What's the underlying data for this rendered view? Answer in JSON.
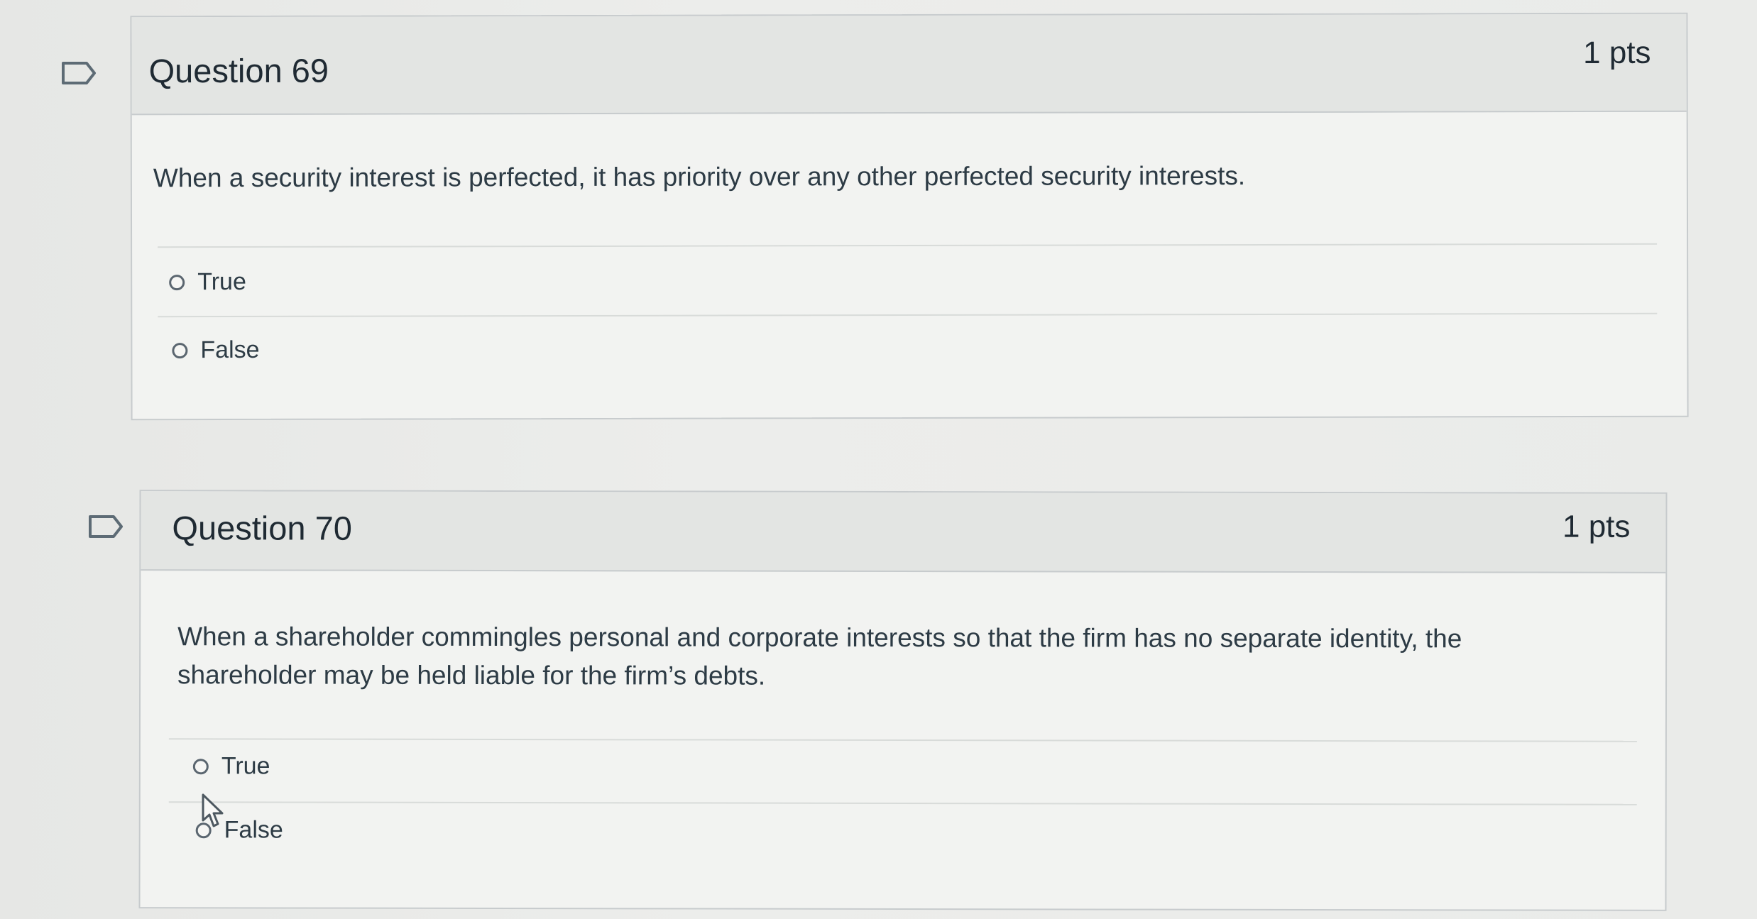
{
  "questions": [
    {
      "title": "Question 69",
      "points": "1 pts",
      "text": "When a security interest is perfected, it has priority over any other perfected security interests.",
      "answers": [
        "True",
        "False"
      ]
    },
    {
      "title": "Question 70",
      "points": "1 pts",
      "text_line1": "When a shareholder commingles personal and corporate interests so that the firm has no separate identity, the",
      "text_line2": "shareholder may be held liable for the firm’s debts.",
      "answers": [
        "True",
        "False"
      ]
    }
  ],
  "icons": {
    "flag": "flag-question-icon",
    "cursor": "mouse-pointer-icon"
  },
  "colors": {
    "background": "#eaebe9",
    "card_header": "#e3e5e3",
    "card_body": "#f2f3f1",
    "border": "#c7cbcd",
    "text": "#2d3b45"
  }
}
